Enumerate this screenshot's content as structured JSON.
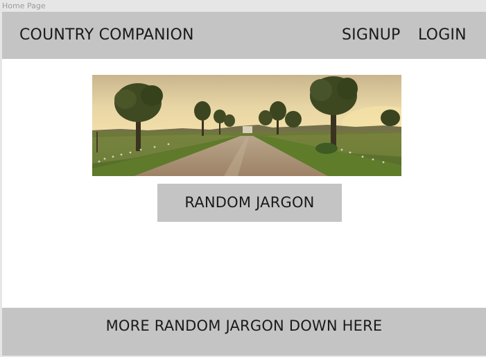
{
  "frame": {
    "label": "Home Page"
  },
  "header": {
    "brand": "COUNTRY COMPANION",
    "nav": {
      "signup_label": "SIGNUP",
      "login_label": "LOGIN"
    }
  },
  "hero": {
    "image": "country-road-landscape"
  },
  "main": {
    "cta_label": "RANDOM JARGON"
  },
  "footer": {
    "text": "MORE RANDOM JARGON DOWN HERE"
  },
  "colors": {
    "frame_bg": "#e6e6e6",
    "bar_gray": "#c4c4c4",
    "canvas_bg": "#ffffff",
    "text_dark": "#1a1a1a"
  }
}
